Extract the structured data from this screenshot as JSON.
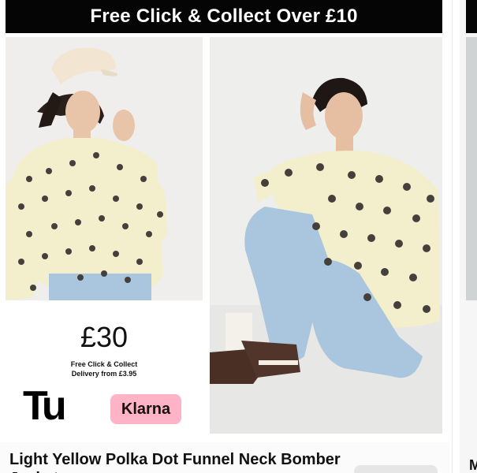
{
  "banner": {
    "text": "Free Click & Collect Over £10"
  },
  "images": {
    "photo1": "Model wearing light yellow polka dot bomber jacket, standing",
    "photo2": "Model wearing light yellow polka dot bomber jacket, sitting"
  },
  "promo": {
    "price": "£30",
    "line1": "Free Click & Collect",
    "line2": "Delivery from £3.95",
    "brand_logo": "Tu",
    "payment_logo": "Klarna"
  },
  "product": {
    "title": "Light Yellow Polka Dot Funnel Neck Bomber Jacket"
  },
  "next_product": {
    "title_initial": "M"
  },
  "colors": {
    "banner_bg": "#050505",
    "jacket": "#f3eecb",
    "dots": "#46403c",
    "jeans": "#a9c6de",
    "klarna_pink": "#ffb3c7"
  }
}
